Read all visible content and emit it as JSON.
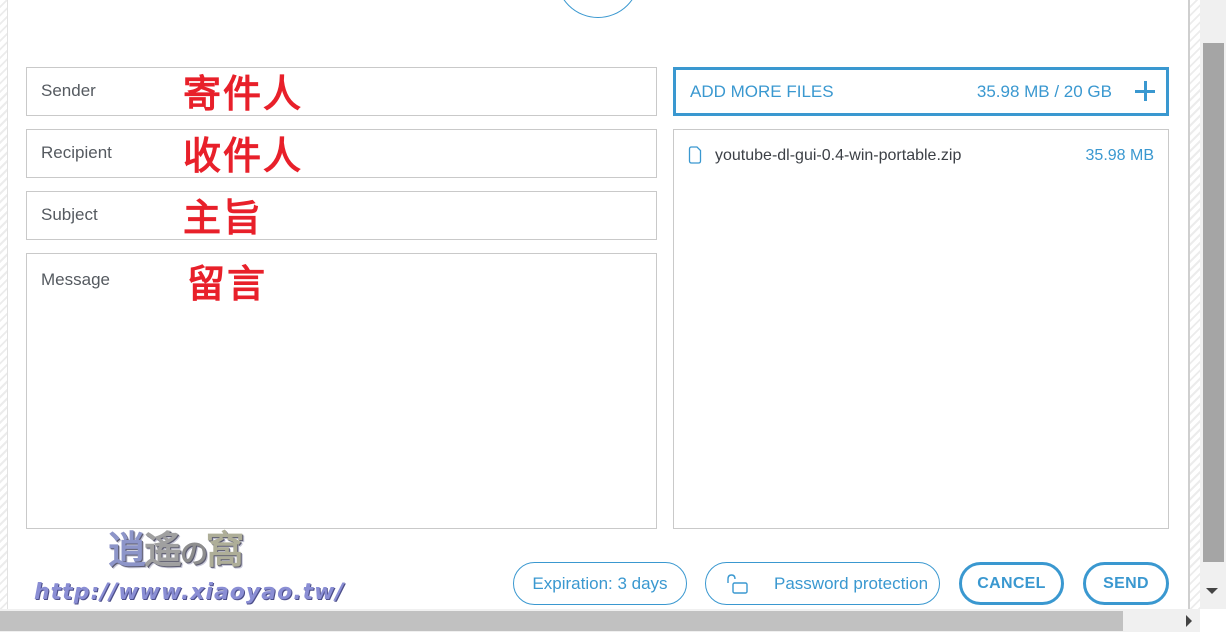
{
  "form": {
    "sender": {
      "placeholder": "Sender",
      "annotation": "寄件人"
    },
    "recipient": {
      "placeholder": "Recipient",
      "annotation": "收件人"
    },
    "subject": {
      "placeholder": "Subject",
      "annotation": "主旨"
    },
    "message": {
      "placeholder": "Message",
      "annotation": "留言"
    }
  },
  "files": {
    "add_label": "ADD MORE FILES",
    "usage": "35.98 MB / 20 GB",
    "items": [
      {
        "name": "youtube-dl-gui-0.4-win-portable.zip",
        "size": "35.98 MB"
      }
    ]
  },
  "actions": {
    "expiration_label": "Expiration: 3 days",
    "password_label": "Password protection",
    "cancel_label": "CANCEL",
    "send_label": "SEND"
  },
  "watermark": {
    "chars": [
      "逍",
      "遙",
      "の",
      "窩"
    ],
    "url": "http://www.xiaoyao.tw/"
  },
  "colors": {
    "accent": "#3a98d0",
    "annotation": "#e8202a",
    "border": "#c9c9c9"
  }
}
